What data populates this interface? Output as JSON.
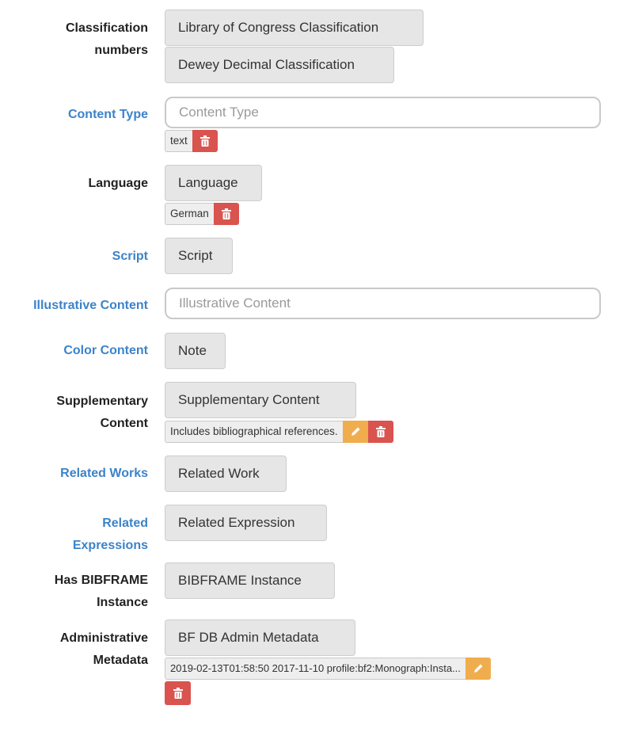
{
  "fields": {
    "classification": {
      "label_line1": "Classification",
      "label_line2": "numbers",
      "buttons": [
        "Library of Congress Classification",
        "Dewey Decimal Classification"
      ]
    },
    "content_type": {
      "label": "Content Type",
      "placeholder": "Content Type",
      "tag": "text"
    },
    "language": {
      "label": "Language",
      "button": "Language",
      "tag": "German"
    },
    "script": {
      "label": "Script",
      "button": "Script"
    },
    "illustrative_content": {
      "label": "Illustrative Content",
      "placeholder": "Illustrative Content"
    },
    "color_content": {
      "label": "Color Content",
      "button": "Note"
    },
    "supplementary_content": {
      "label_line1": "Supplementary",
      "label_line2": "Content",
      "button": "Supplementary Content",
      "tag": "Includes bibliographical references."
    },
    "related_works": {
      "label": "Related Works",
      "button": "Related Work"
    },
    "related_expressions": {
      "label_line1": "Related",
      "label_line2": "Expressions",
      "button": "Related Expression"
    },
    "has_instance": {
      "label_line1": "Has BIBFRAME",
      "label_line2": "Instance",
      "button": "BIBFRAME Instance"
    },
    "admin_metadata": {
      "label_line1": "Administrative",
      "label_line2": "Metadata",
      "button": "BF DB Admin Metadata",
      "tag": "2019-02-13T01:58:50 2017-11-10 profile:bf2:Monograph:Insta..."
    }
  },
  "colors": {
    "link_label": "#3c83c9",
    "edit_button": "#f0ad4e",
    "delete_button": "#d9534f"
  },
  "icons": {
    "edit": "pencil-icon",
    "delete": "trash-icon"
  }
}
